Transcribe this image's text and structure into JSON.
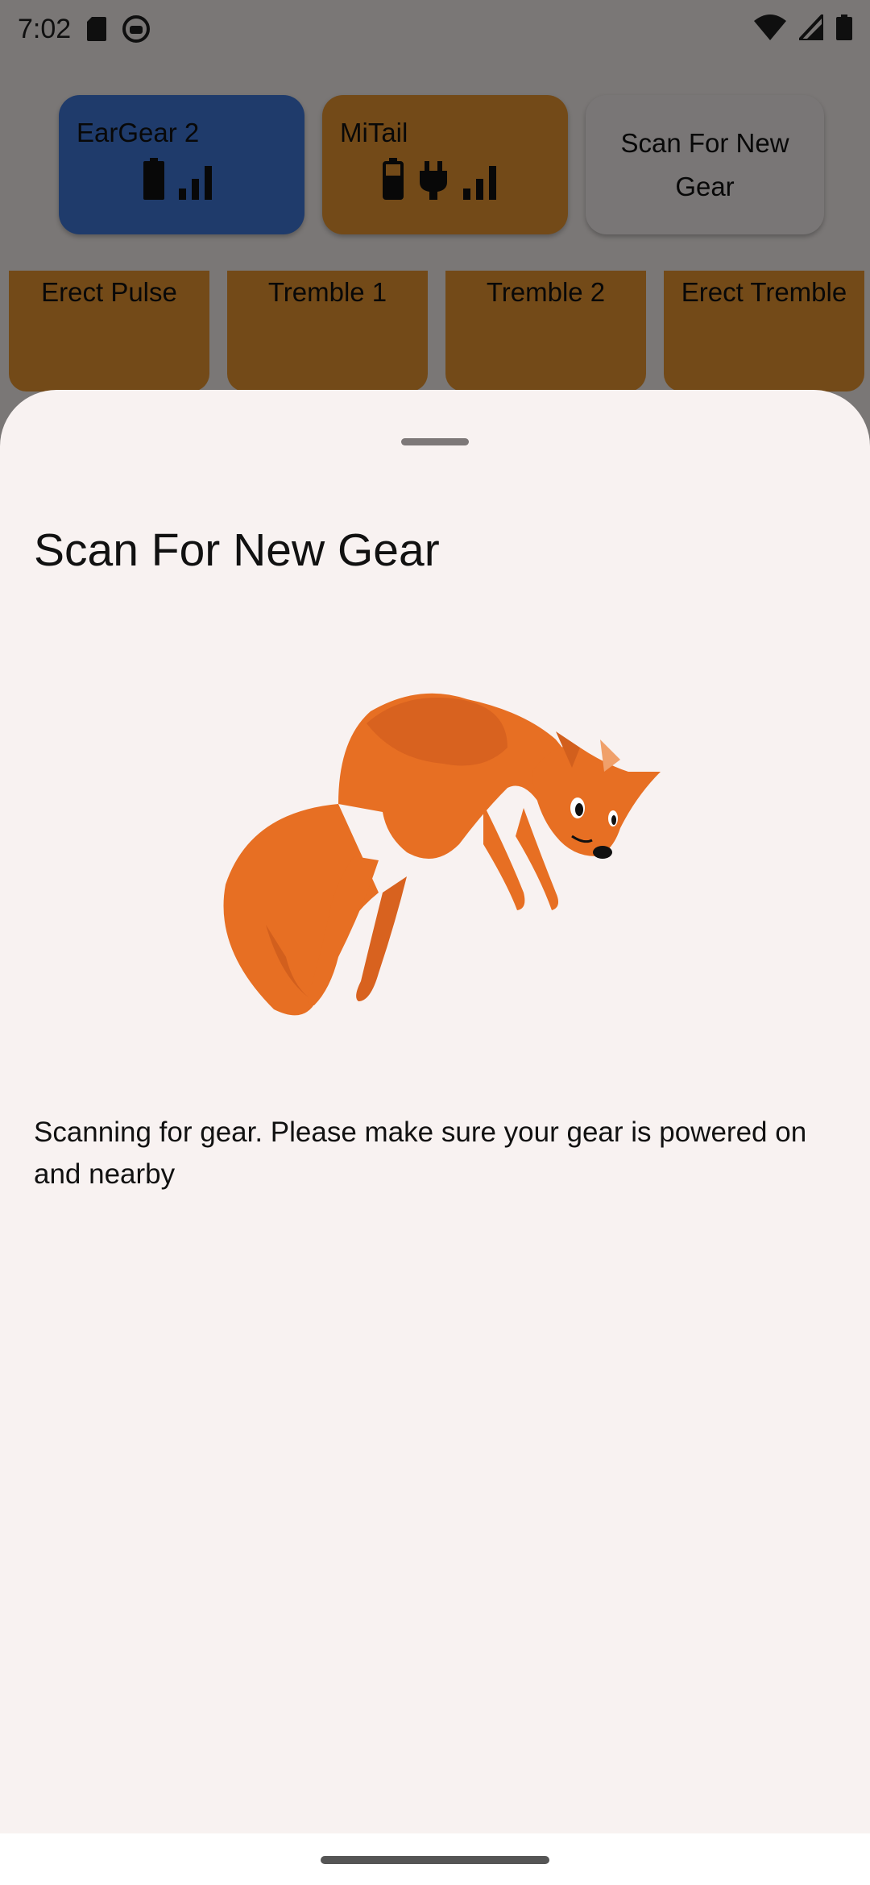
{
  "status_bar": {
    "time": "7:02",
    "icons": [
      "sd-card-icon",
      "android-debug-icon",
      "wifi-icon",
      "cell-signal-icon",
      "battery-icon"
    ]
  },
  "gear_devices": [
    {
      "name": "EarGear 2",
      "color": "#3f77d7",
      "icons": [
        "battery-full-icon",
        "signal-bars-icon"
      ]
    },
    {
      "name": "MiTail",
      "color": "#e69430",
      "icons": [
        "battery-icon",
        "charging-plug-icon",
        "signal-bars-icon"
      ]
    }
  ],
  "scan_button": {
    "label": "Scan For New Gear"
  },
  "actions": [
    {
      "label": "Erect Pulse"
    },
    {
      "label": "Tremble 1"
    },
    {
      "label": "Tremble 2"
    },
    {
      "label": "Erect Tremble"
    }
  ],
  "sheet": {
    "title": "Scan For New Gear",
    "illustration": "pouncing-fox",
    "message": "Scanning for gear. Please make sure your gear is powered on and nearby"
  },
  "colors": {
    "eargear_card": "#3f77d7",
    "mitail_card": "#e69430",
    "sheet_background": "#f8f2f1",
    "fox": "#e76f23"
  }
}
